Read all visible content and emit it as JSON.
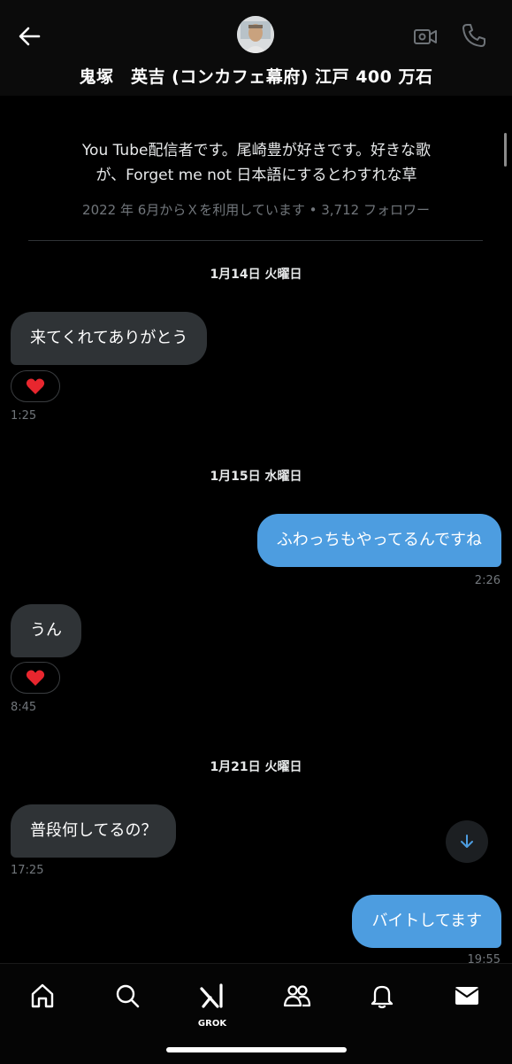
{
  "header": {
    "title": "鬼塚　英吉 (コンカフェ幕府) 江戸 400 万石"
  },
  "profile": {
    "bio_line1": "You Tube配信者です。尾崎豊が好きです。好きな歌",
    "bio_line2": "が、Forget me not 日本語にするとわすれな草",
    "meta": "2022 年 6月からＸを利用しています • 3,712 フォロワー"
  },
  "messages": {
    "date1": "1月14日 火曜日",
    "msg1": "来てくれてありがとう",
    "reaction1": "❤️",
    "time1": "1:25",
    "date2": "1月15日 水曜日",
    "msg2": "ふわっちもやってるんですね",
    "time2": "2:26",
    "msg3": "うん",
    "reaction3": "❤️",
    "time3": "8:45",
    "date3": "1月21日 火曜日",
    "msg4": "普段何してるの？",
    "time4": "17:25",
    "msg5": "バイトしてます",
    "time5": "19:55"
  },
  "bottom_nav": {
    "grok_label": "GROK"
  }
}
